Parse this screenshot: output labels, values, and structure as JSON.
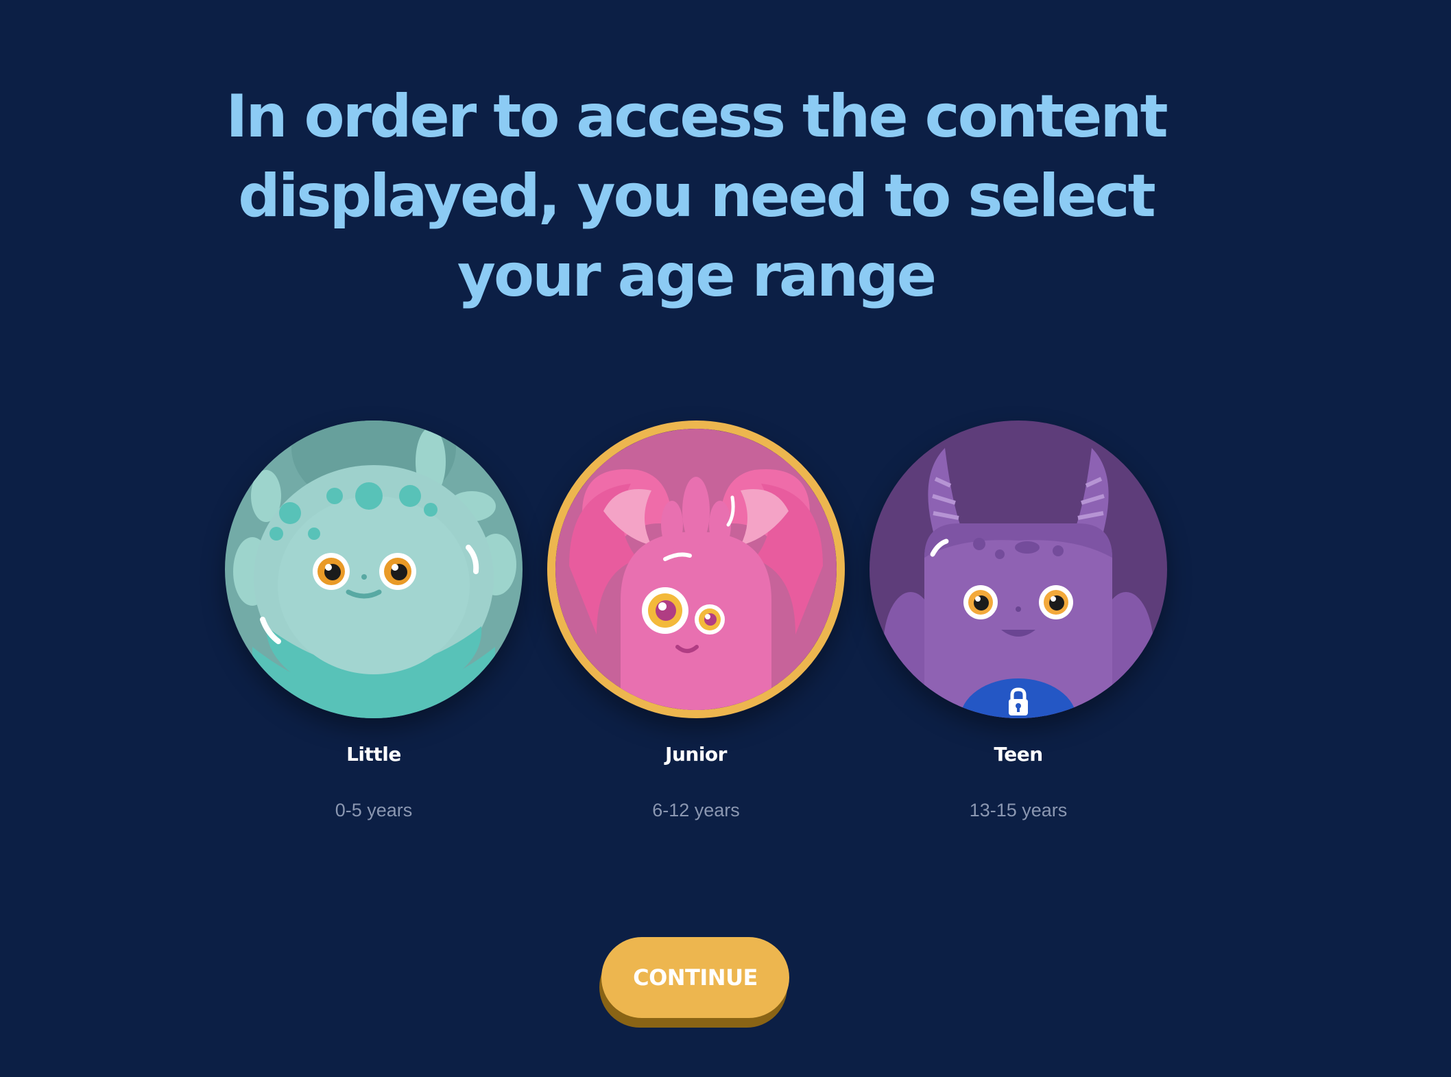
{
  "heading": "In order to access the content displayed, you need to select your age range",
  "age_options": [
    {
      "label": "Little",
      "range": "0-5 years",
      "selected": false,
      "locked": false
    },
    {
      "label": "Junior",
      "range": "6-12 years",
      "selected": true,
      "locked": false
    },
    {
      "label": "Teen",
      "range": "13-15 years",
      "selected": false,
      "locked": true
    }
  ],
  "continue_label": "CONTINUE",
  "colors": {
    "background": "#0c1f45",
    "heading": "#8ccbf4",
    "accent": "#edb64f",
    "little": "#9dd4cc",
    "junior": "#ea73b1",
    "teen": "#8f62b1",
    "lock_badge": "#2457c5"
  },
  "icons": [
    "little-monster-icon",
    "junior-monster-icon",
    "teen-monster-icon",
    "lock-icon"
  ]
}
